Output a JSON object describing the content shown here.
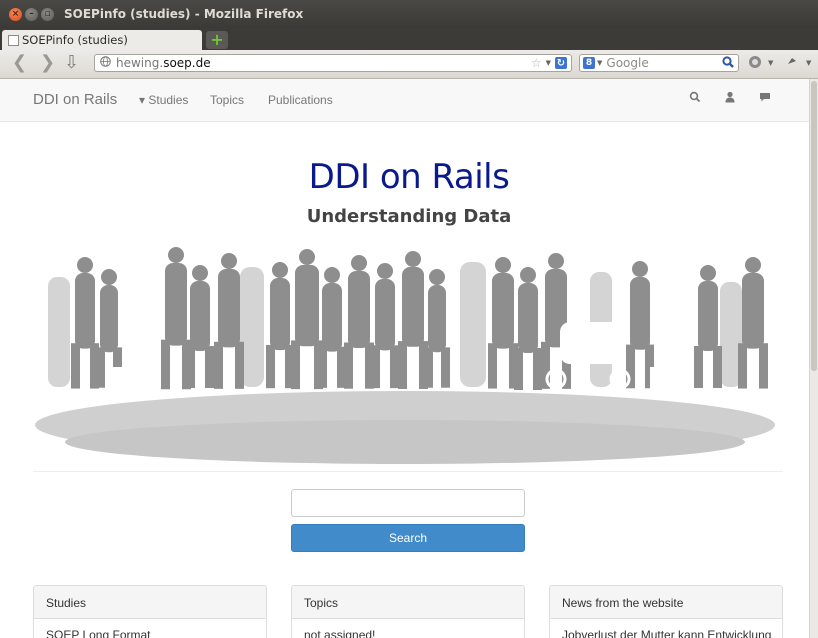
{
  "window": {
    "title": "SOEPinfo (studies) - Mozilla Firefox",
    "close_glyph": "×",
    "min_glyph": "–",
    "max_glyph": "▫"
  },
  "tabs": [
    {
      "label": "SOEPinfo (studies)"
    }
  ],
  "new_tab_glyph": "+",
  "toolbar": {
    "back_glyph": "❮",
    "forward_glyph": "❯",
    "download_glyph": "⇩",
    "url_prefix": "hewing.",
    "url_domain": "soep.de",
    "search_engine_letter": "8",
    "search_placeholder": "Google",
    "search_go_glyph": "🔍"
  },
  "site": {
    "brand": "DDI on Rails",
    "nav": [
      {
        "label": "▾ Studies"
      },
      {
        "label": "Topics"
      },
      {
        "label": "Publications"
      }
    ],
    "icons": [
      "search-icon",
      "user-icon",
      "comment-icon"
    ],
    "hero_title": "DDI on Rails",
    "hero_subtitle": "Understanding Data",
    "search_button": "Search",
    "panels": [
      {
        "title": "Studies",
        "first_item": "SOEP Long Format"
      },
      {
        "title": "Topics",
        "first_item": "not assigned!"
      },
      {
        "title": "News from the website",
        "first_item": "Jobverlust der Mutter kann Entwicklung"
      }
    ]
  },
  "colors": {
    "hero_title": "#0a1a8a",
    "primary_button": "#428bca",
    "crowd_dark": "#8e8e8e",
    "crowd_light": "#c4c4c4"
  }
}
